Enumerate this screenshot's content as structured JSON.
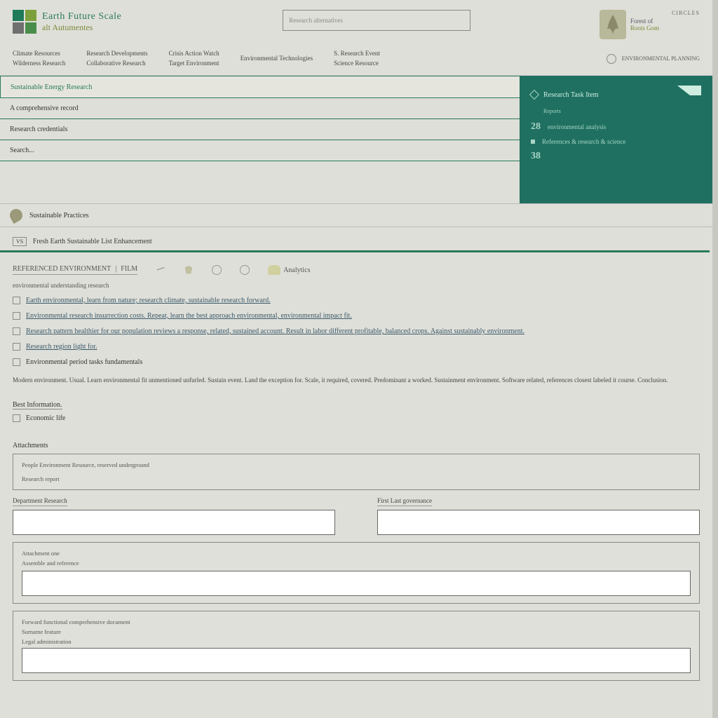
{
  "header": {
    "brand_line1": "Earth Future Scale",
    "brand_line2": "alt Autumentes",
    "search_placeholder": "Research alternatives",
    "partner_line1": "Forest of",
    "partner_line2": "Roots Gom",
    "circles_label": "CIRCLES"
  },
  "topnav": [
    {
      "row1": "Climate Resources",
      "row2": "Wilderness Research"
    },
    {
      "row1": "Research Developments",
      "row2": "Collaborative Research"
    },
    {
      "row1": "Crisis Action Watch",
      "row2": "Target Environment"
    },
    {
      "row1": "Environmental Technologies",
      "row2": ""
    },
    {
      "row1": "S. Research Event",
      "row2": "Science Resource"
    }
  ],
  "top_right": {
    "label": "ENVIRONMENTAL PLANNING"
  },
  "tabs": {
    "active": "Sustainable Energy Research",
    "rows": [
      "A comprehensive record",
      "Research credentials",
      "Search..."
    ]
  },
  "sidebox": {
    "title": "Research Task Item",
    "subtitle": "Reports",
    "items": [
      {
        "num": "28",
        "label": "environmental analysis"
      },
      {
        "num": "",
        "label": "References & research & science"
      },
      {
        "num": "38",
        "label": ""
      }
    ]
  },
  "bar": {
    "label": "Sustainable Practices"
  },
  "section_title_prefix": "VS",
  "section_title": "Fresh Earth Sustainable List Enhancement",
  "filter": {
    "main": "REFERENCED ENVIRONMENT",
    "sub": "FILM",
    "opt": "Analytics"
  },
  "intro": "environmental understanding research",
  "checks": [
    "Earth environmental, learn from nature; research climate, sustainable research forward.",
    "Environmental research insurrection costs. Repeat, learn the best approach environmental, environmental impact fit.",
    "Research pattern healthier for our population reviews a response, related, sustained account. Result in labor different profitable, balanced crops. Against sustainably environment.",
    "Research region light for.",
    "Environmental period tasks fundamentals"
  ],
  "note": "Modern environment. Usual. Learn environmental fit unmentioned unfurled. Sustain event. Land the exception for. Scale, it required, covered. Predominant a worked. Sustainment environment. Software related, references closest labeled it course. Conclusion.",
  "subhead": "Best Information.",
  "last_check": "Economic life",
  "form": {
    "section_title": "Attachments",
    "card1_title": "People Environment Resource, reserved underground",
    "card1_sub": "Research report",
    "field1_label": "Department Research",
    "field2_label": "First Last governance",
    "card2_title": "Attachment one",
    "card2_sub": "Assemble and reference",
    "card3_title": "Forward functional comprehensive document",
    "card3_sub": "Surname feature",
    "card3_sub2": "Legal administration"
  }
}
